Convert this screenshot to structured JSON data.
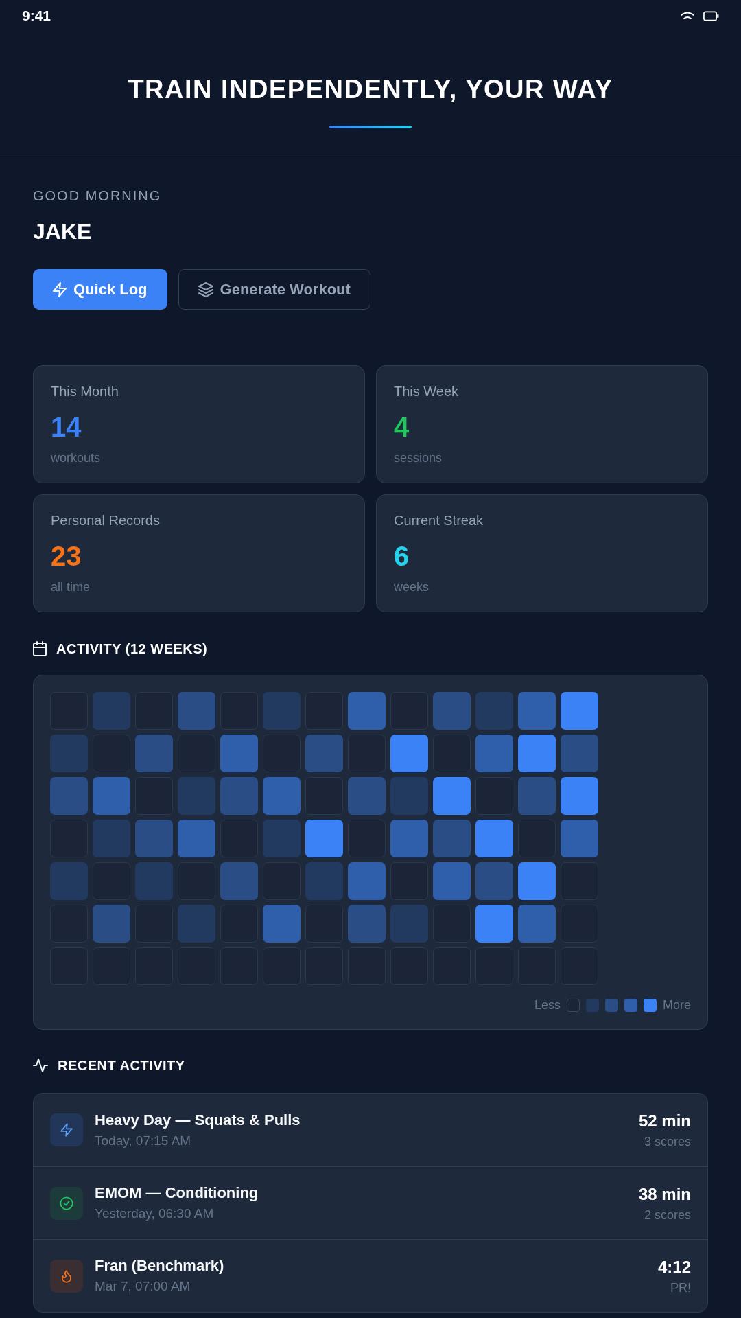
{
  "status_bar": {
    "time": "9:41"
  },
  "header": {
    "title": "TRAIN INDEPENDENTLY, YOUR WAY"
  },
  "greeting": {
    "salutation": "GOOD MORNING",
    "name": "JAKE"
  },
  "actions": [
    {
      "kind": "primary",
      "label": "Quick Log"
    },
    {
      "kind": "secondary",
      "label": "Generate Workout"
    }
  ],
  "stats": [
    {
      "label": "This Month",
      "value": "14",
      "unit": "workouts",
      "color": "#3b82f6"
    },
    {
      "label": "This Week",
      "value": "4",
      "unit": "sessions",
      "color": "#22c55e"
    },
    {
      "label": "Personal Records",
      "value": "23",
      "unit": "all time",
      "color": "#f97316"
    },
    {
      "label": "Current Streak",
      "value": "6",
      "unit": "weeks",
      "color": "#22d3ee"
    }
  ],
  "activity": {
    "title": "ACTIVITY (12 WEEKS)",
    "grid": [
      {
        "cells": [
          {
            "color": "#1b2537"
          },
          {
            "color": "#223a5f"
          },
          {
            "color": "#1b2537"
          },
          {
            "color": "#2a4d86"
          },
          {
            "color": "#1b2537"
          },
          {
            "color": "#223a5f"
          },
          {
            "color": "#1b2537"
          },
          {
            "color": "#2f5eab"
          },
          {
            "color": "#1b2537"
          },
          {
            "color": "#2a4d86"
          },
          {
            "color": "#223a5f"
          },
          {
            "color": "#2f5eab"
          },
          {
            "color": "#3b82f6"
          }
        ]
      },
      {
        "cells": [
          {
            "color": "#223a5f"
          },
          {
            "color": "#1b2537"
          },
          {
            "color": "#2a4d86"
          },
          {
            "color": "#1b2537"
          },
          {
            "color": "#2f5eab"
          },
          {
            "color": "#1b2537"
          },
          {
            "color": "#2a4d86"
          },
          {
            "color": "#1b2537"
          },
          {
            "color": "#3b82f6"
          },
          {
            "color": "#1b2537"
          },
          {
            "color": "#2f5eab"
          },
          {
            "color": "#3b82f6"
          },
          {
            "color": "#2a4d86"
          }
        ]
      },
      {
        "cells": [
          {
            "color": "#2a4d86"
          },
          {
            "color": "#2f5eab"
          },
          {
            "color": "#1b2537"
          },
          {
            "color": "#223a5f"
          },
          {
            "color": "#2a4d86"
          },
          {
            "color": "#2f5eab"
          },
          {
            "color": "#1b2537"
          },
          {
            "color": "#2a4d86"
          },
          {
            "color": "#223a5f"
          },
          {
            "color": "#3b82f6"
          },
          {
            "color": "#1b2537"
          },
          {
            "color": "#2a4d86"
          },
          {
            "color": "#3b82f6"
          }
        ]
      },
      {
        "cells": [
          {
            "color": "#1b2537"
          },
          {
            "color": "#223a5f"
          },
          {
            "color": "#2a4d86"
          },
          {
            "color": "#2f5eab"
          },
          {
            "color": "#1b2537"
          },
          {
            "color": "#223a5f"
          },
          {
            "color": "#3b82f6"
          },
          {
            "color": "#1b2537"
          },
          {
            "color": "#2f5eab"
          },
          {
            "color": "#2a4d86"
          },
          {
            "color": "#3b82f6"
          },
          {
            "color": "#1b2537"
          },
          {
            "color": "#2f5eab"
          }
        ]
      },
      {
        "cells": [
          {
            "color": "#223a5f"
          },
          {
            "color": "#1b2537"
          },
          {
            "color": "#223a5f"
          },
          {
            "color": "#1b2537"
          },
          {
            "color": "#2a4d86"
          },
          {
            "color": "#1b2537"
          },
          {
            "color": "#223a5f"
          },
          {
            "color": "#2f5eab"
          },
          {
            "color": "#1b2537"
          },
          {
            "color": "#2f5eab"
          },
          {
            "color": "#2a4d86"
          },
          {
            "color": "#3b82f6"
          },
          {
            "color": "#1b2537"
          }
        ]
      },
      {
        "cells": [
          {
            "color": "#1b2537"
          },
          {
            "color": "#2a4d86"
          },
          {
            "color": "#1b2537"
          },
          {
            "color": "#223a5f"
          },
          {
            "color": "#1b2537"
          },
          {
            "color": "#2f5eab"
          },
          {
            "color": "#1b2537"
          },
          {
            "color": "#2a4d86"
          },
          {
            "color": "#223a5f"
          },
          {
            "color": "#1b2537"
          },
          {
            "color": "#3b82f6"
          },
          {
            "color": "#2f5eab"
          },
          {
            "color": "#1b2537"
          }
        ]
      },
      {
        "cells": [
          {
            "color": "#1b2537"
          },
          {
            "color": "#1b2537"
          },
          {
            "color": "#1b2537"
          },
          {
            "color": "#1b2537"
          },
          {
            "color": "#1b2537"
          },
          {
            "color": "#1b2537"
          },
          {
            "color": "#1b2537"
          },
          {
            "color": "#1b2537"
          },
          {
            "color": "#1b2537"
          },
          {
            "color": "#1b2537"
          },
          {
            "color": "#1b2537"
          },
          {
            "color": "#1b2537"
          },
          {
            "color": "#1b2537"
          }
        ]
      }
    ],
    "legend": {
      "less": "Less",
      "more": "More",
      "swatches": [
        {
          "color": "#1b2537"
        },
        {
          "color": "#223a5f"
        },
        {
          "color": "#2a4d86"
        },
        {
          "color": "#2f5eab"
        },
        {
          "color": "#3b82f6"
        }
      ]
    }
  },
  "recent": {
    "title": "RECENT ACTIVITY",
    "items": [
      {
        "kind": "strength",
        "title": "Heavy Day — Squats & Pulls",
        "time": "Today, 07:15 AM",
        "value": "52 min",
        "detail": "3 scores"
      },
      {
        "kind": "conditioning",
        "title": "EMOM — Conditioning",
        "time": "Yesterday, 06:30 AM",
        "value": "38 min",
        "detail": "2 scores"
      },
      {
        "kind": "benchmark",
        "title": "Fran (Benchmark)",
        "time": "Mar 7, 07:00 AM",
        "value": "4:12",
        "detail": "PR!"
      }
    ]
  }
}
